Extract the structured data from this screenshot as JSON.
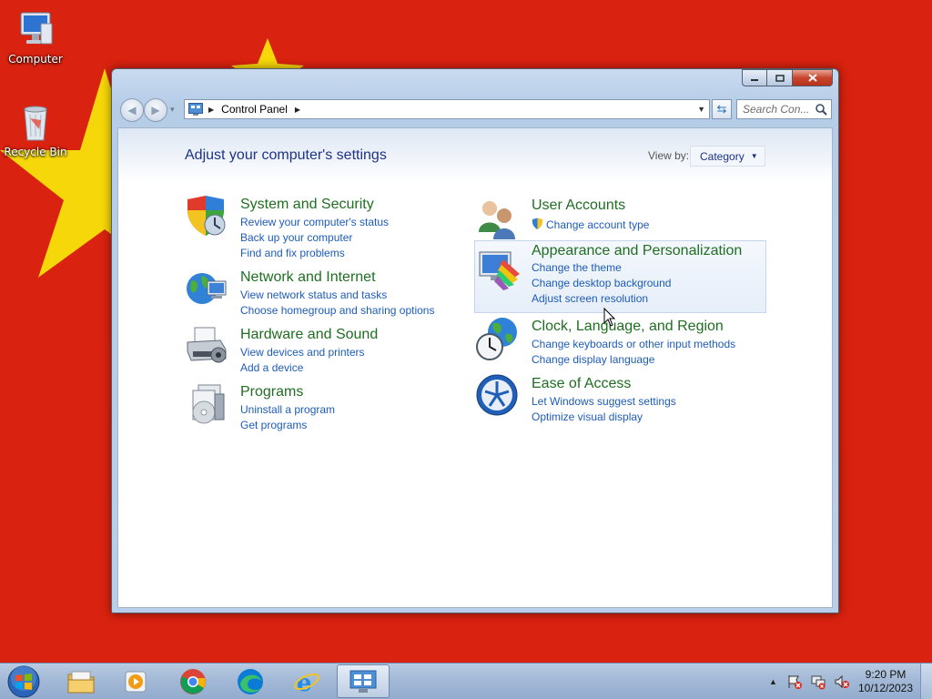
{
  "desktop": {
    "icons": [
      {
        "label": "Computer",
        "icon": "computer-icon"
      },
      {
        "label": "Recycle Bin",
        "icon": "recycle-bin-icon"
      }
    ],
    "colors": {
      "wallpaper": "#d9220f",
      "star": "#f6d70a"
    }
  },
  "window": {
    "address": {
      "crumbs": [
        "Control Panel"
      ],
      "icon": "control-panel-icon"
    },
    "search": {
      "placeholder": "Search Con..."
    },
    "controls": {
      "minimize": "minimize-icon",
      "maximize": "maximize-icon",
      "close": "close-icon"
    },
    "heading": "Adjust your computer's settings",
    "view_by": {
      "label": "View by:",
      "value": "Category"
    },
    "categories": [
      {
        "title": "System and Security",
        "icon": "shield-icon",
        "links": [
          "Review your computer's status",
          "Back up your computer",
          "Find and fix problems"
        ]
      },
      {
        "title": "Network and Internet",
        "icon": "network-globe-icon",
        "links": [
          "View network status and tasks",
          "Choose homegroup and sharing options"
        ]
      },
      {
        "title": "Hardware and Sound",
        "icon": "printer-icon",
        "links": [
          "View devices and printers",
          "Add a device"
        ]
      },
      {
        "title": "Programs",
        "icon": "programs-icon",
        "links": [
          "Uninstall a program",
          "Get programs"
        ]
      },
      {
        "title": "User Accounts",
        "icon": "users-icon",
        "links": [
          "Change account type"
        ]
      },
      {
        "title": "Appearance and Personalization",
        "icon": "monitor-palette-icon",
        "links": [
          "Change the theme",
          "Change desktop background",
          "Adjust screen resolution"
        ]
      },
      {
        "title": "Clock, Language, and Region",
        "icon": "clock-globe-icon",
        "links": [
          "Change keyboards or other input methods",
          "Change display language"
        ]
      },
      {
        "title": "Ease of Access",
        "icon": "ease-of-access-icon",
        "links": [
          "Let Windows suggest settings",
          "Optimize visual display"
        ]
      }
    ],
    "colors": {
      "category_title": "#1f6e21",
      "link": "#1d5cba",
      "heading": "#1e3287"
    }
  },
  "taskbar": {
    "start": "windows-start-icon",
    "items": [
      "file-explorer-icon",
      "media-player-icon",
      "chrome-icon",
      "edge-icon",
      "internet-explorer-icon",
      "control-panel-icon"
    ],
    "clock": {
      "time": "9:20 PM",
      "date": "10/12/2023"
    }
  }
}
